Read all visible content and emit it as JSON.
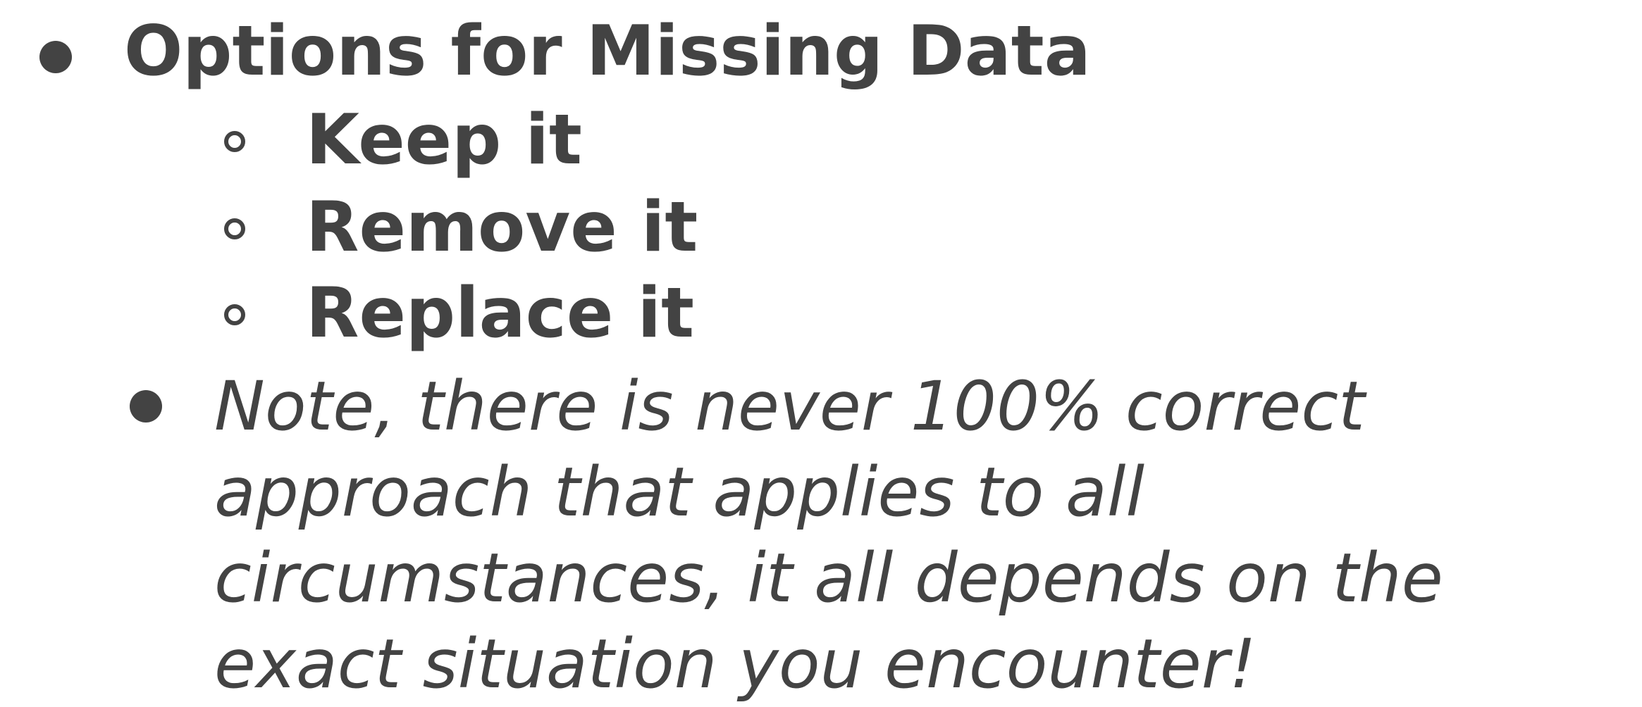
{
  "slide": {
    "main_bullet": {
      "heading": "Options for Missing Data",
      "sub_items": [
        {
          "label": "Keep it"
        },
        {
          "label": "Remove it"
        },
        {
          "label": "Replace it"
        }
      ]
    },
    "note": {
      "lines": [
        "Note, there is never 100% correct",
        "approach that applies to all",
        "circumstances, it all depends on the",
        "exact situation you encounter!"
      ]
    }
  },
  "colors": {
    "text": "#434343",
    "background": "#ffffff"
  },
  "icons": {
    "main_bullet": "filled-disc-bullet-icon",
    "sub_bullet": "hollow-circle-bullet-icon"
  }
}
